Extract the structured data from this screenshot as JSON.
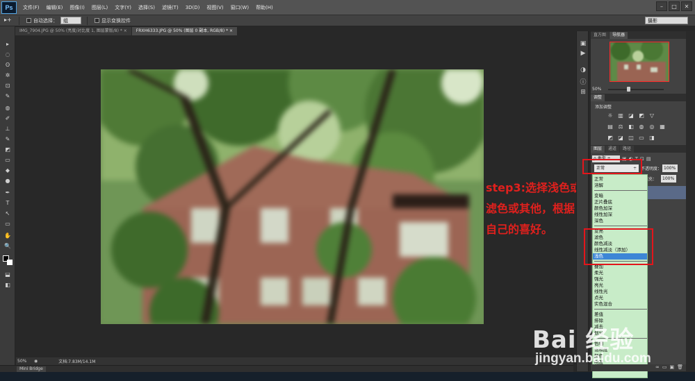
{
  "app": {
    "logo": "Ps"
  },
  "menu": [
    "文件(F)",
    "编辑(E)",
    "图像(I)",
    "图层(L)",
    "文字(Y)",
    "选择(S)",
    "滤镜(T)",
    "3D(D)",
    "视图(V)",
    "窗口(W)",
    "帮助(H)"
  ],
  "window_controls": [
    "–",
    "□",
    "✕"
  ],
  "options": {
    "tool_glyph": "▸+",
    "auto_select_label": "自动选择：",
    "auto_select_value": "组",
    "show_transform_label": "显示变换控件",
    "workspace": "摄影"
  },
  "tabs": [
    {
      "label": "IMG_7904.JPG @ 50% (亮度/对比度 1, 图层蒙版/8) *  ×",
      "active": false
    },
    {
      "label": "FRXH6333.JPG @ 50% (图层 0 副本, RGB/8) *  ×",
      "active": true
    }
  ],
  "tools": [
    "▸",
    "◌",
    "ʘ",
    "✲",
    "⊡",
    "✎",
    "◍",
    "✐",
    "⊥",
    "✎",
    "◩",
    "▭",
    "◆",
    "●",
    "✒",
    "T",
    "↖",
    "▭",
    "✋",
    "🔍",
    "⬓",
    "◧",
    "▣"
  ],
  "annotation": {
    "text": "step3:选择浅色或滤色或其他，根据自己的喜好。",
    "color": "#e0201d"
  },
  "status": {
    "zoom": "50%",
    "doc": "文档:7.83M/14.1M"
  },
  "bridge": {
    "label": "Mini Bridge"
  },
  "navigator": {
    "tabs": [
      "直方图",
      "导航器"
    ],
    "zoom": "50%"
  },
  "adjustments": {
    "tab": "调整",
    "title": "添加调整"
  },
  "layers": {
    "tabs": [
      "图层",
      "通道",
      "路径"
    ],
    "kind": "ρ 类型 ÷",
    "kind_icons": [
      "▣",
      "◐",
      "T",
      "⊡",
      "▤"
    ],
    "blend_mode": "正常",
    "opacity_label": "不透明度：",
    "opacity": "100%",
    "fill_label": "填充：",
    "fill": "100%"
  },
  "blend_groups": [
    [
      "正常",
      "溶解"
    ],
    [
      "变暗",
      "正片叠底",
      "颜色加深",
      "线性加深",
      "深色"
    ],
    [
      "变亮",
      "滤色",
      "颜色减淡",
      "线性减淡（添加）",
      "浅色"
    ],
    [
      "叠加",
      "柔光",
      "强光",
      "亮光",
      "线性光",
      "点光",
      "实色混合"
    ],
    [
      "差值",
      "排除",
      "减去",
      "划分"
    ],
    [
      "色相",
      "饱和度",
      "颜色",
      "明度"
    ]
  ],
  "selected_blend": "浅色",
  "watermark": {
    "brand": "Bai 经验",
    "url": "jingyan.baidu.com"
  }
}
